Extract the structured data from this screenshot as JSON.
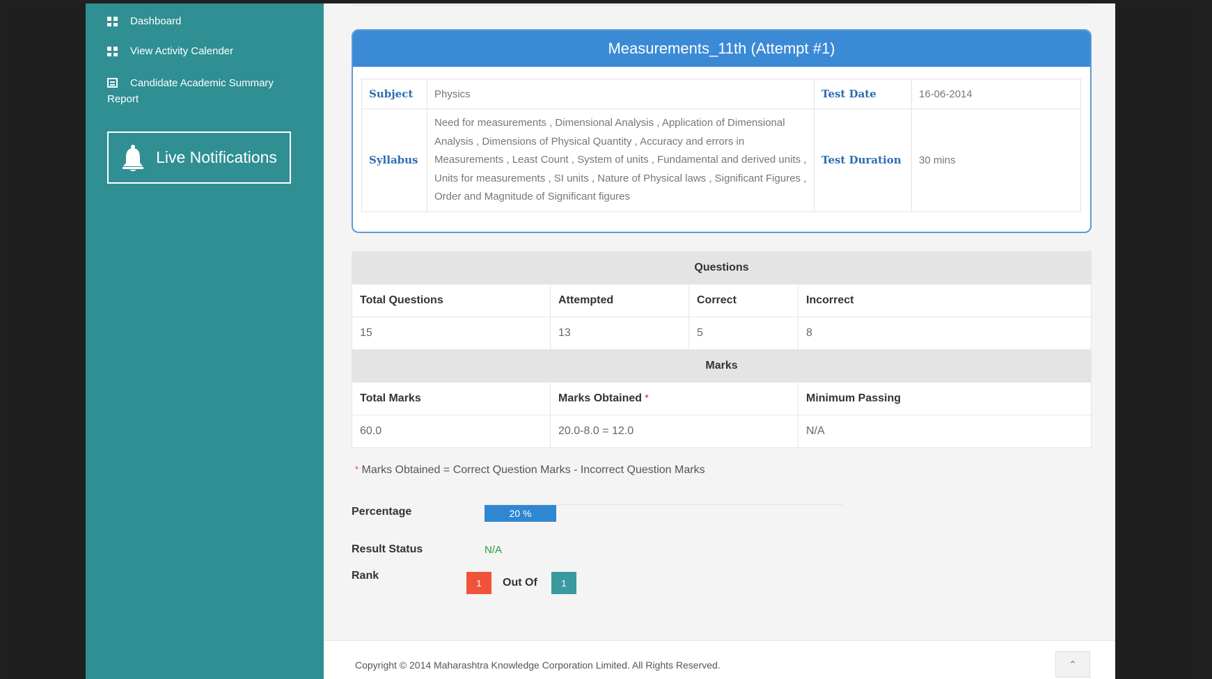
{
  "sidebar": {
    "items": [
      {
        "label": "Dashboard",
        "icon": "grid-icon"
      },
      {
        "label": "View Activity Calender",
        "icon": "grid-icon"
      },
      {
        "label": "Candidate Academic Summary Report",
        "icon": "document-icon"
      }
    ],
    "live_notifications": "Live Notifications"
  },
  "test": {
    "title": "Measurements_11th (Attempt #1)",
    "subject_label": "Subject",
    "subject": "Physics",
    "test_date_label": "Test Date",
    "test_date": "16-06-2014",
    "syllabus_label": "Syllabus",
    "syllabus": "Need for measurements , Dimensional Analysis , Application of Dimensional Analysis , Dimensions of Physical Quantity , Accuracy and errors in Measurements , Least Count , System of units , Fundamental and derived units , Units for measurements , SI units , Nature of Physical laws , Significant Figures , Order and Magnitude of Significant figures",
    "duration_label": "Test Duration",
    "duration": "30 mins"
  },
  "questions": {
    "section": "Questions",
    "headers": [
      "Total Questions",
      "Attempted",
      "Correct",
      "Incorrect"
    ],
    "values": [
      "15",
      "13",
      "5",
      "8"
    ]
  },
  "marks": {
    "section": "Marks",
    "headers": [
      "Total Marks",
      "Marks Obtained",
      "Minimum Passing"
    ],
    "star": "*",
    "values": [
      "60.0",
      "20.0-8.0 = 12.0",
      "N/A"
    ]
  },
  "note": {
    "star": "*",
    "text": "Marks Obtained = Correct Question Marks - Incorrect Question Marks"
  },
  "percentage": {
    "label": "Percentage",
    "value": 20,
    "text": "20 %"
  },
  "result_status": {
    "label": "Result Status",
    "value": "N/A"
  },
  "rank": {
    "label": "Rank",
    "value": "1",
    "out_of_label": "Out Of",
    "total": "1"
  },
  "footer": {
    "copyright": "Copyright © 2014 Maharashtra Knowledge Corporation Limited. All Rights Reserved.",
    "top_icon": "chevron-up-icon"
  },
  "colors": {
    "sidebar": "#2f8f93",
    "panel_header": "#3b8ad6",
    "progress": "#2f86d1",
    "rank": "#f0533a",
    "rank_total": "#3a9aa0",
    "pass_text": "#2a9a3a"
  }
}
